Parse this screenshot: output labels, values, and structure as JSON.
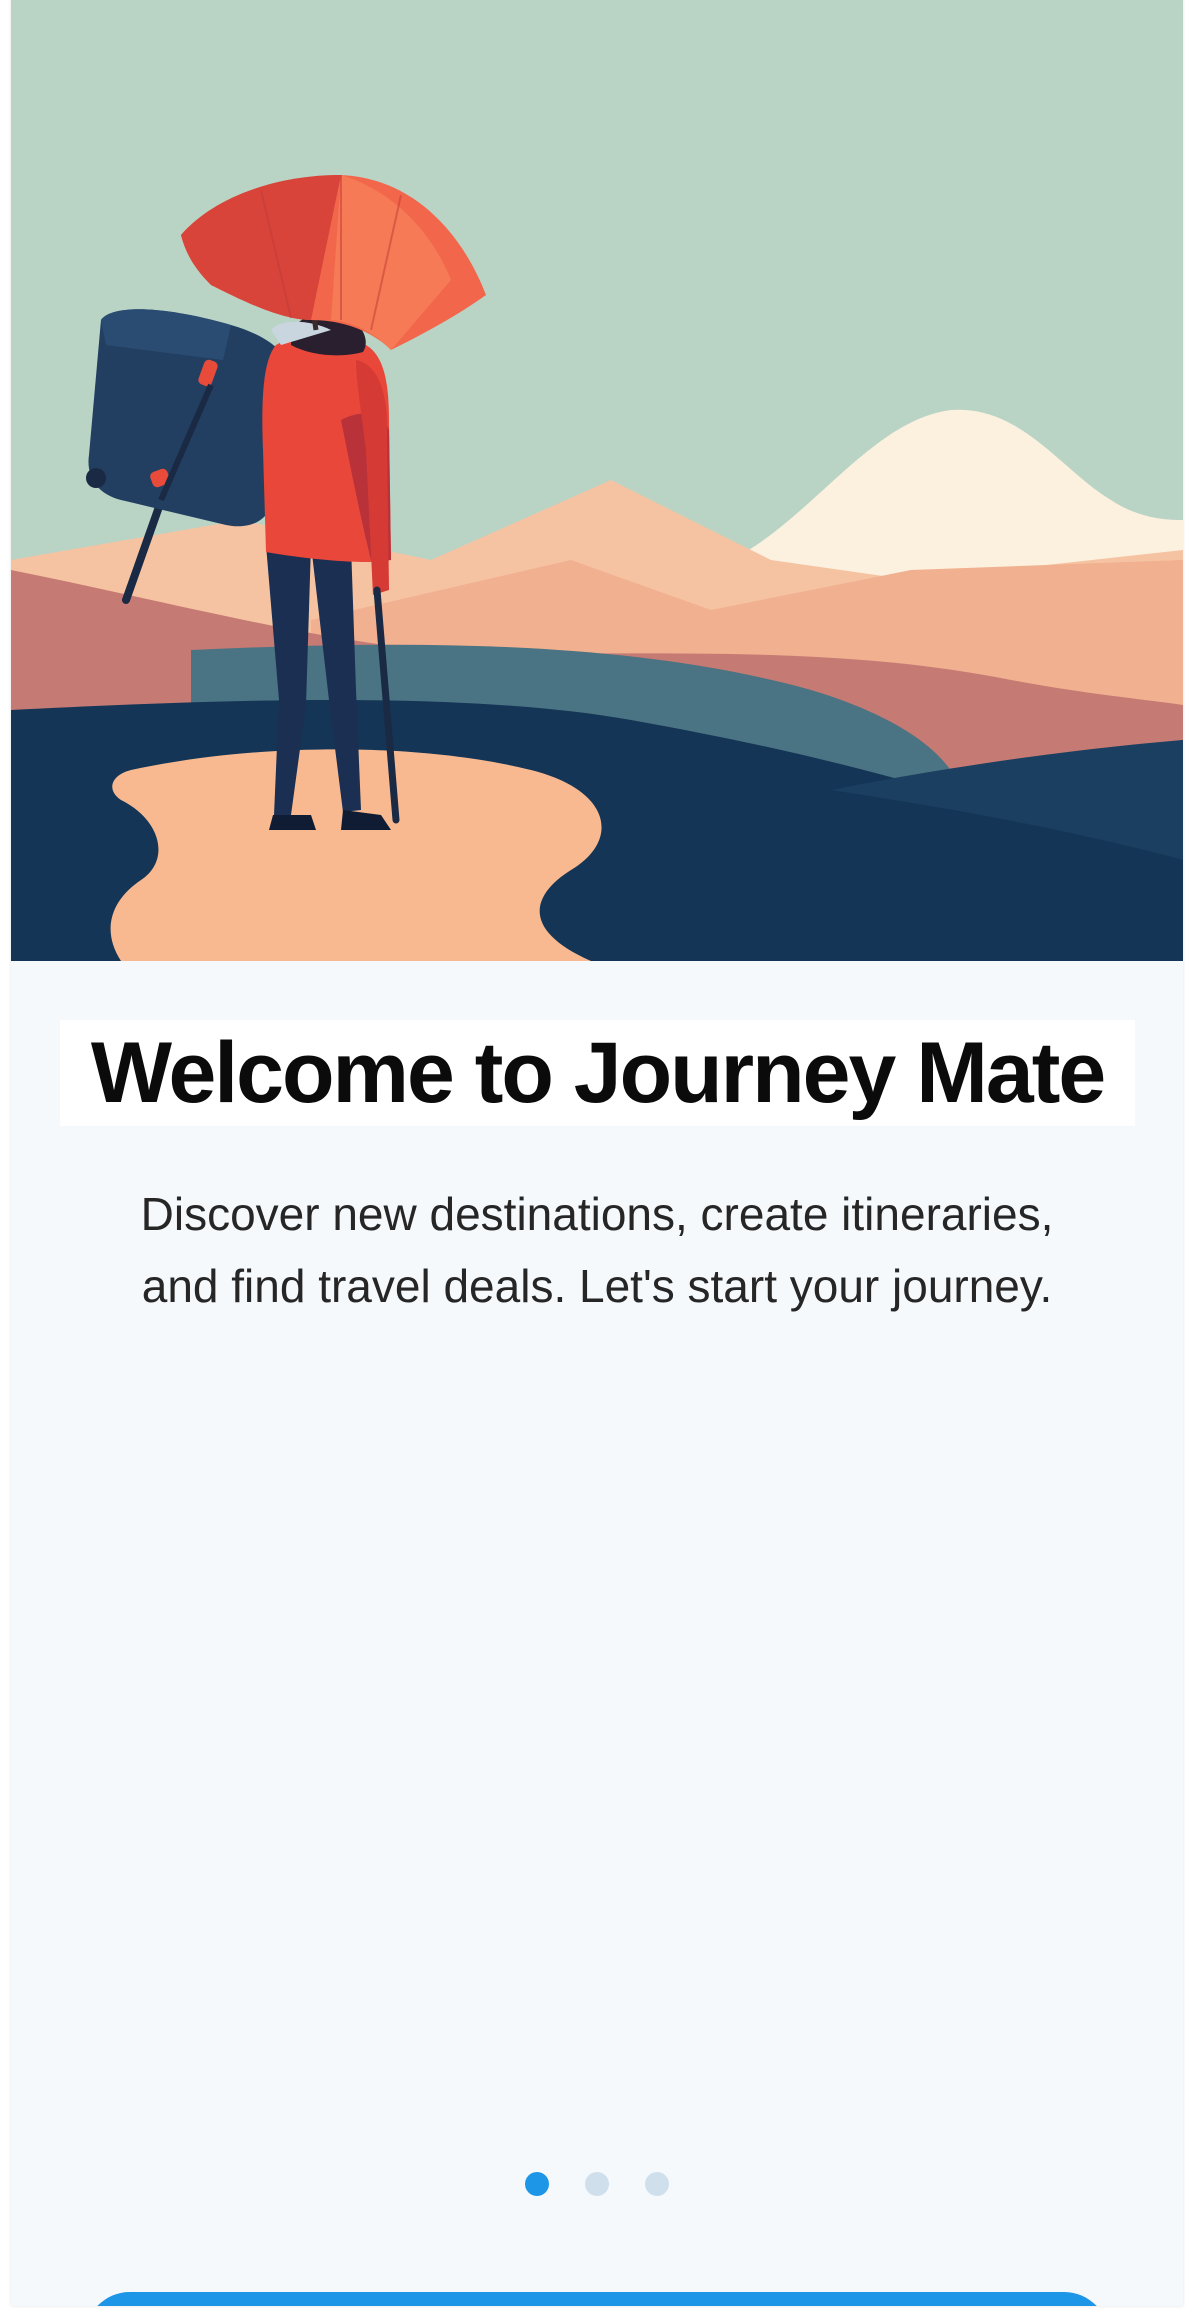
{
  "onboarding": {
    "title": "Welcome to Journey Mate",
    "subtitle_line1": "Discover new destinations, create itineraries,",
    "subtitle_line2": "and find travel deals. Let's start your journey.",
    "hero_image": "traveler-with-umbrella-illustration",
    "pager": {
      "total": 3,
      "current": 1
    },
    "colors": {
      "accent": "#1e96e8",
      "dot_inactive": "#cfdfeb",
      "background": "#f5f9fc",
      "sky": "#b9d3c5"
    }
  }
}
